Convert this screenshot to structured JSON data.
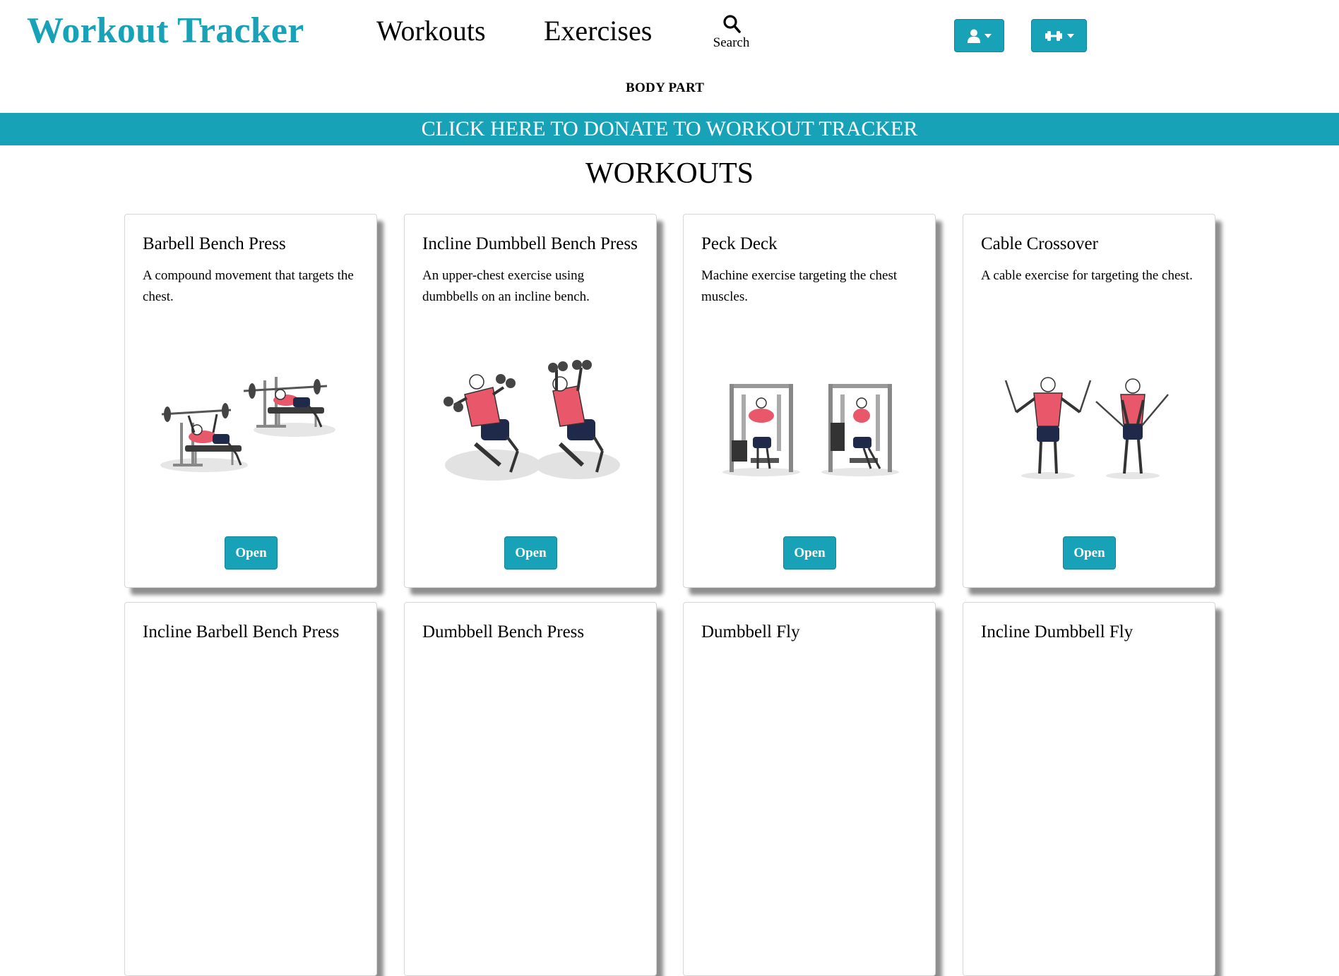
{
  "nav": {
    "brand": "Workout Tracker",
    "workouts_label": "Workouts",
    "exercises_label": "Exercises",
    "search_label": "Search",
    "user_menu_icon": "user-icon",
    "weights_menu_icon": "dumbbell-icon",
    "body_part_label": "BODY PART"
  },
  "banner": {
    "donate_text": "CLICK HERE TO DONATE TO WORKOUT TRACKER"
  },
  "page": {
    "title": "WORKOUTS"
  },
  "colors": {
    "accent": "#17a2b8",
    "muscle_highlight": "#e8586a",
    "shorts": "#1f2a4a"
  },
  "cards": [
    {
      "title": "Barbell Bench Press",
      "description": "A compound movement that targets the chest.",
      "button": "Open",
      "image": "barbell-bench-press-illustration"
    },
    {
      "title": "Incline Dumbbell Bench Press",
      "description": "An upper-chest exercise using dumbbells on an incline bench.",
      "button": "Open",
      "image": "incline-dumbbell-press-illustration"
    },
    {
      "title": "Peck Deck",
      "description": "Machine exercise targeting the chest muscles.",
      "button": "Open",
      "image": "peck-deck-illustration"
    },
    {
      "title": "Cable Crossover",
      "description": "A cable exercise for targeting the chest.",
      "button": "Open",
      "image": "cable-crossover-illustration"
    },
    {
      "title": "Incline Barbell Bench Press",
      "description": "",
      "button": "",
      "image": ""
    },
    {
      "title": "Dumbbell Bench Press",
      "description": "",
      "button": "",
      "image": ""
    },
    {
      "title": "Dumbbell Fly",
      "description": "",
      "button": "",
      "image": ""
    },
    {
      "title": "Incline Dumbbell Fly",
      "description": "",
      "button": "",
      "image": ""
    }
  ]
}
